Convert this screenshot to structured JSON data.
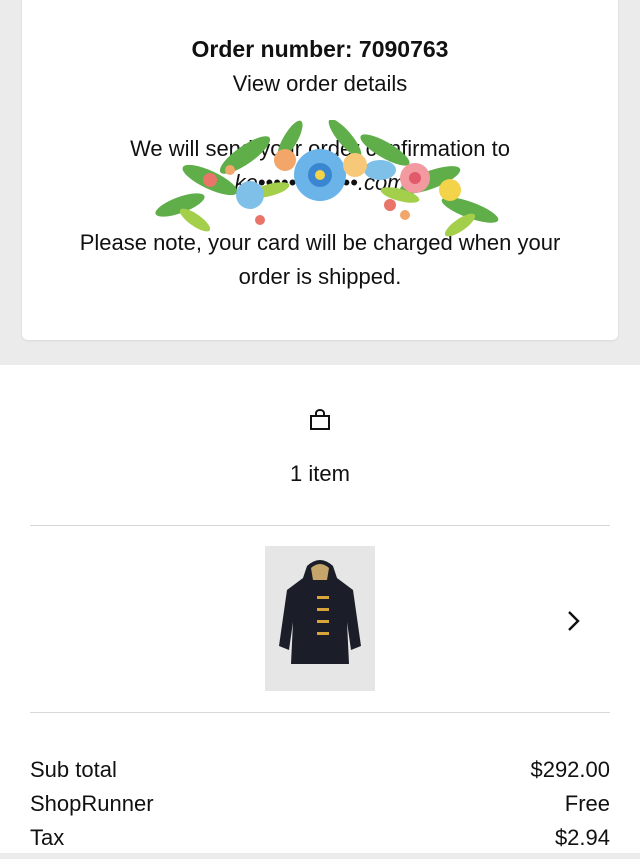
{
  "order": {
    "number_label": "Order number: 7090763",
    "view_details": "View order details",
    "confirmation_text": "We will send your order confirmation to",
    "email": "ke•••••••••••••.com",
    "note": "Please note, your card will be charged when your order is shipped."
  },
  "items": {
    "icon": "shopping-bag-icon",
    "count_label": "1 item",
    "products": [
      {
        "image": "black-duffle-coat"
      }
    ]
  },
  "summary": {
    "rows": [
      {
        "label": "Sub total",
        "value": "$292.00"
      },
      {
        "label": "ShopRunner",
        "value": "Free"
      },
      {
        "label": "Tax",
        "value": "$2.94"
      }
    ]
  },
  "colors": {
    "background": "#ebebeb",
    "card": "#ffffff",
    "text": "#111111",
    "divider": "#d8d8d8",
    "thumbnail_bg": "#e6e6e6",
    "toggle_accent": "#d9a53a"
  }
}
